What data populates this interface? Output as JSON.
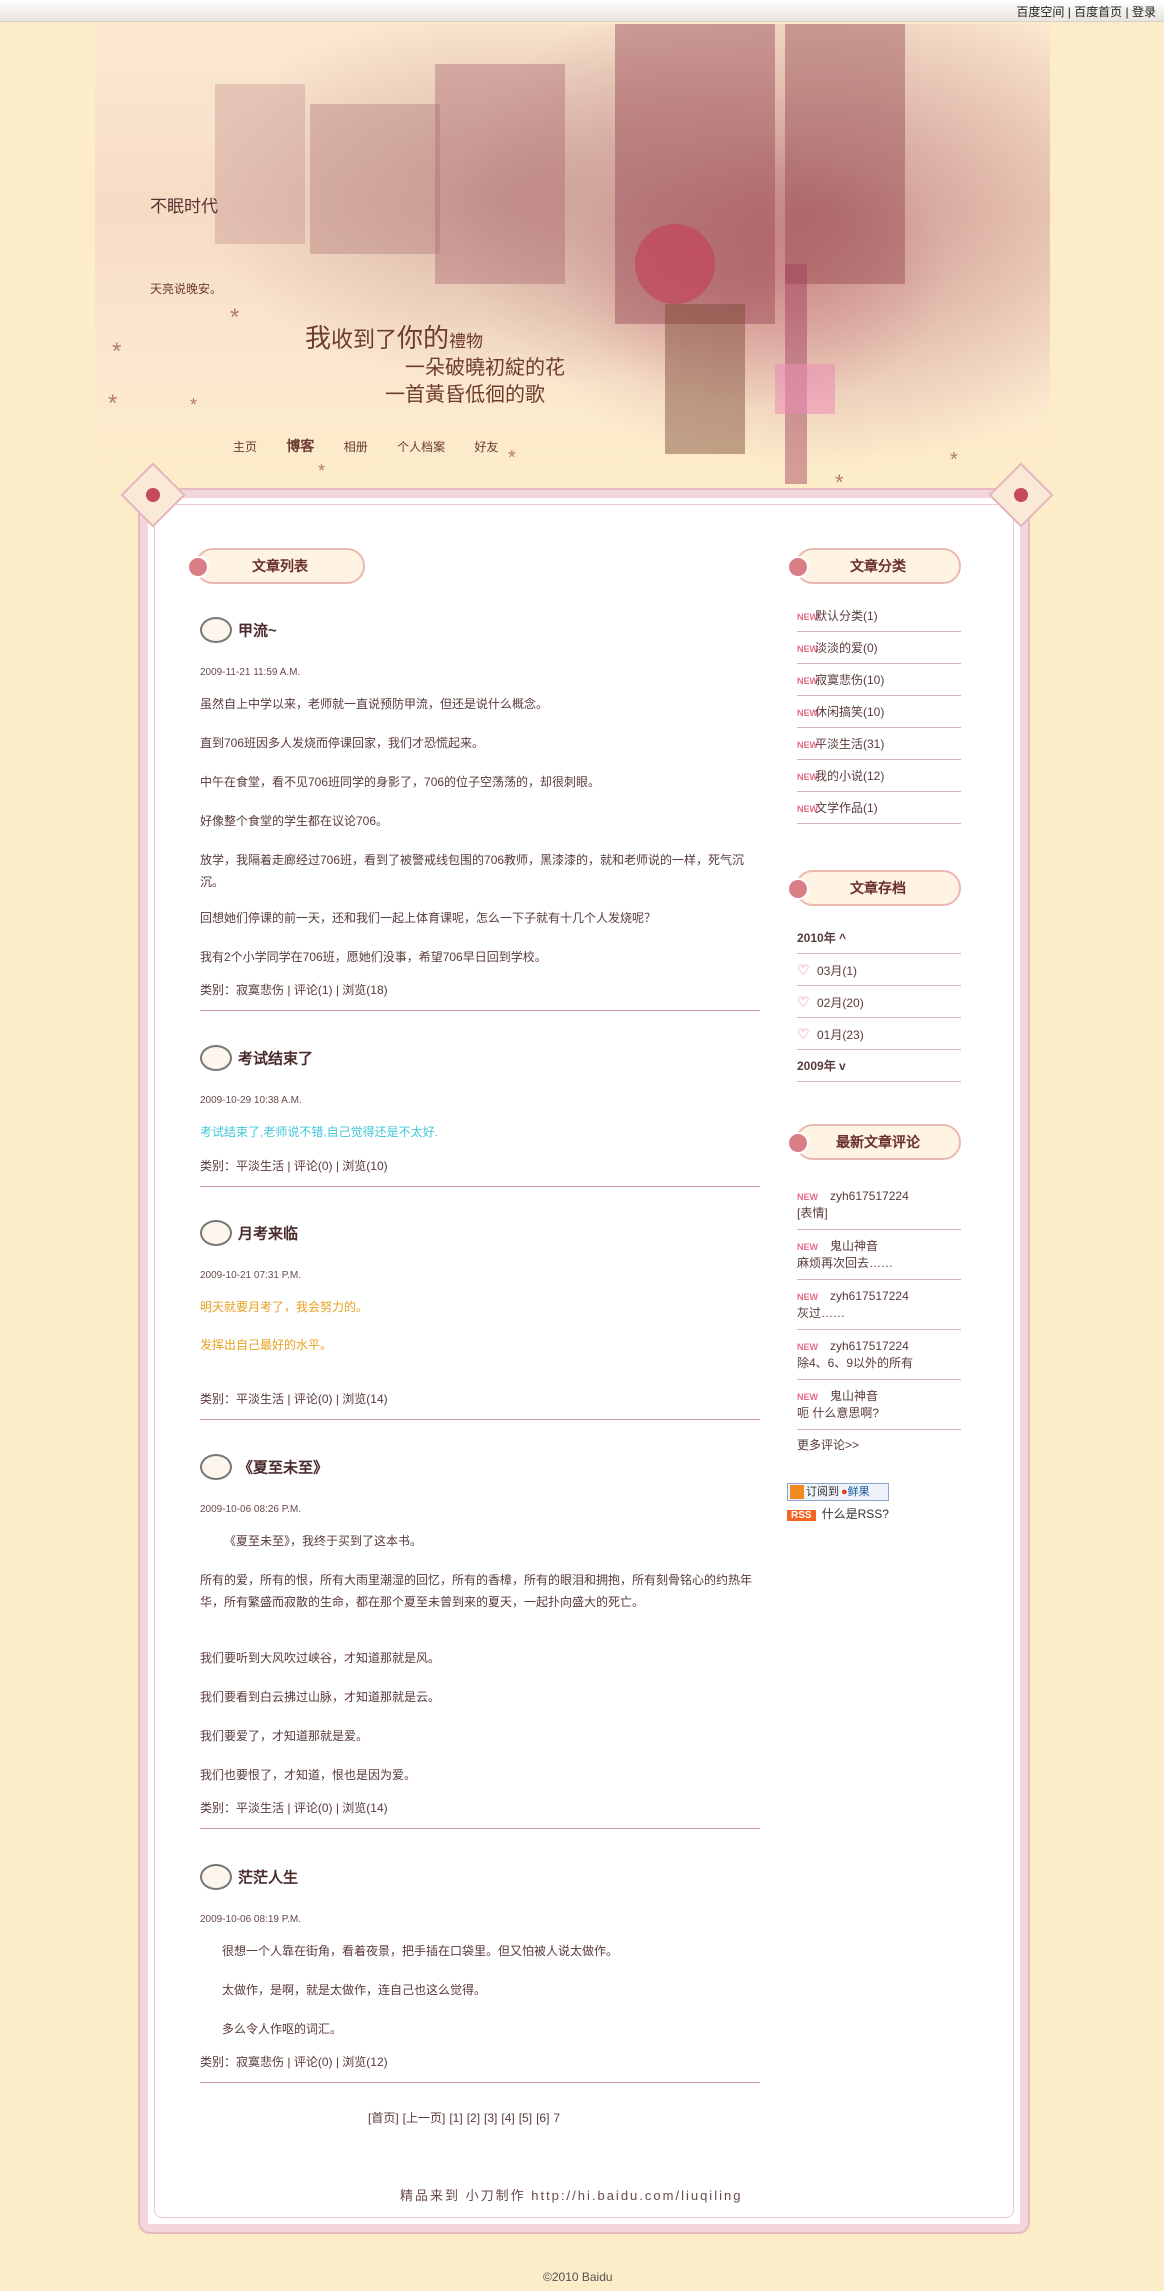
{
  "topbar": {
    "link1": "百度空间",
    "sep1": "|",
    "link2": "百度首页",
    "sep2": "|",
    "link3": "登录"
  },
  "header": {
    "blog_name": "不眠时代",
    "blog_desc": "天亮说晚安。",
    "poem_l1a": "我",
    "poem_l1b": "收到了",
    "poem_l1c": "你的",
    "poem_l1d": "禮物",
    "poem_l2": "一朵破曉初綻的花",
    "poem_l3": "一首黃昏低徊的歌"
  },
  "nav": {
    "home": "主页",
    "blog": "博客",
    "album": "相册",
    "profile": "个人档案",
    "friends": "好友"
  },
  "main": {
    "list_title": "文章列表"
  },
  "posts": [
    {
      "title": "甲流~",
      "date": "2009-11-21 11:59 A.M.",
      "paras": [
        "虽然自上中学以来，老师就一直说预防甲流，但还是说什么概念。",
        "直到706班因多人发烧而停课回家，我们才恐慌起来。",
        "中午在食堂，看不见706班同学的身影了，706的位子空荡荡的，却很刺眼。",
        "好像整个食堂的学生都在议论706。",
        "放学，我隔着走廊经过706班，看到了被警戒线包围的706教师，黑漆漆的，就和老师说的一样，死气沉沉。",
        "回想她们停课的前一天，还和我们一起上体育课呢，怎么一下子就有十几个人发烧呢？",
        "我有2个小学同学在706班，愿她们没事，希望706早日回到学校。"
      ],
      "cat_label": "类别：",
      "cat": "寂寞悲伤",
      "comments": "评论(1)",
      "views": "浏览(18)"
    },
    {
      "title": "考试结束了",
      "date": "2009-10-29 10:38 A.M.",
      "paras": [
        "考试结束了,老师说不错,自己觉得还是不太好."
      ],
      "color": "#3fc8d8",
      "cat_label": "类别：",
      "cat": "平淡生活",
      "comments": "评论(0)",
      "views": "浏览(10)"
    },
    {
      "title": "月考来临",
      "date": "2009-10-21 07:31 P.M.",
      "paras": [
        "明天就要月考了，我会努力的。",
        "发挥出自己最好的水平。"
      ],
      "color": "#e8a020",
      "cat_label": "类别：",
      "cat": "平淡生活",
      "comments": "评论(0)",
      "views": "浏览(14)"
    },
    {
      "title": "《夏至未至》",
      "date": "2009-10-06 08:26 P.M.",
      "paras": [
        "《夏至未至》，我终于买到了这本书。",
        "所有的爱，所有的恨，所有大雨里潮湿的回忆，所有的香樟，所有的眼泪和拥抱，所有刻骨铭心的约热年华，所有繁盛而寂散的生命，都在那个夏至未曾到来的夏天，一起扑向盛大的死亡。",
        "我们要听到大风吹过峡谷，才知道那就是风。",
        "我们要看到白云拂过山脉，才知道那就是云。",
        "我们要爱了，才知道那就是爱。",
        "我们也要恨了，才知道，恨也是因为爱。"
      ],
      "cat_label": "类别：",
      "cat": "平淡生活",
      "comments": "评论(0)",
      "views": "浏览(14)"
    },
    {
      "title": "茫茫人生",
      "date": "2009-10-06 08:19 P.M.",
      "paras": [
        "很想一个人靠在街角，看着夜景，把手插在口袋里。但又怕被人说太做作。",
        "太做作，是啊，就是太做作，连自己也这么觉得。",
        "多么令人作呕的词汇。"
      ],
      "cat_label": "类别：",
      "cat": "寂寞悲伤",
      "comments": "评论(0)",
      "views": "浏览(12)"
    }
  ],
  "pager": {
    "first": "[首页]",
    "prev": "[上一页]",
    "p1": "[1]",
    "p2": "[2]",
    "p3": "[3]",
    "p4": "[4]",
    "p5": "[5]",
    "p6": "[6]",
    "p7": "7"
  },
  "sidebar": {
    "cat_title": "文章分类",
    "categories": [
      "默认分类(1)",
      "淡淡的爱(0)",
      "寂寞悲伤(10)",
      "休闲搞笑(10)",
      "平淡生活(31)",
      "我的小说(12)",
      "文学作品(1)"
    ],
    "archive_title": "文章存档",
    "year2010": "2010年",
    "year2009": "2009年",
    "months": [
      "03月(1)",
      "02月(20)",
      "01月(23)"
    ],
    "comments_title": "最新文章评论",
    "comments": [
      {
        "user": "zyh617517224",
        "text": "[表情]"
      },
      {
        "user": "鬼山神音",
        "text": "麻烦再次回去……"
      },
      {
        "user": "zyh617517224",
        "text": "灰过……"
      },
      {
        "user": "zyh617517224",
        "text": "除4、6、9以外的所有"
      },
      {
        "user": "鬼山神音",
        "text": "呃 什么意思啊?"
      }
    ],
    "more": "更多评论>>",
    "subscribe": "订阅到",
    "xianguo": "鲜果",
    "rss": "RSS",
    "whatrss": "什么是RSS?"
  },
  "footer": {
    "signature": "精品来到  小刀制作  http://hi.baidu.com/liuqiling",
    "copyright": "©2010 Baidu"
  }
}
